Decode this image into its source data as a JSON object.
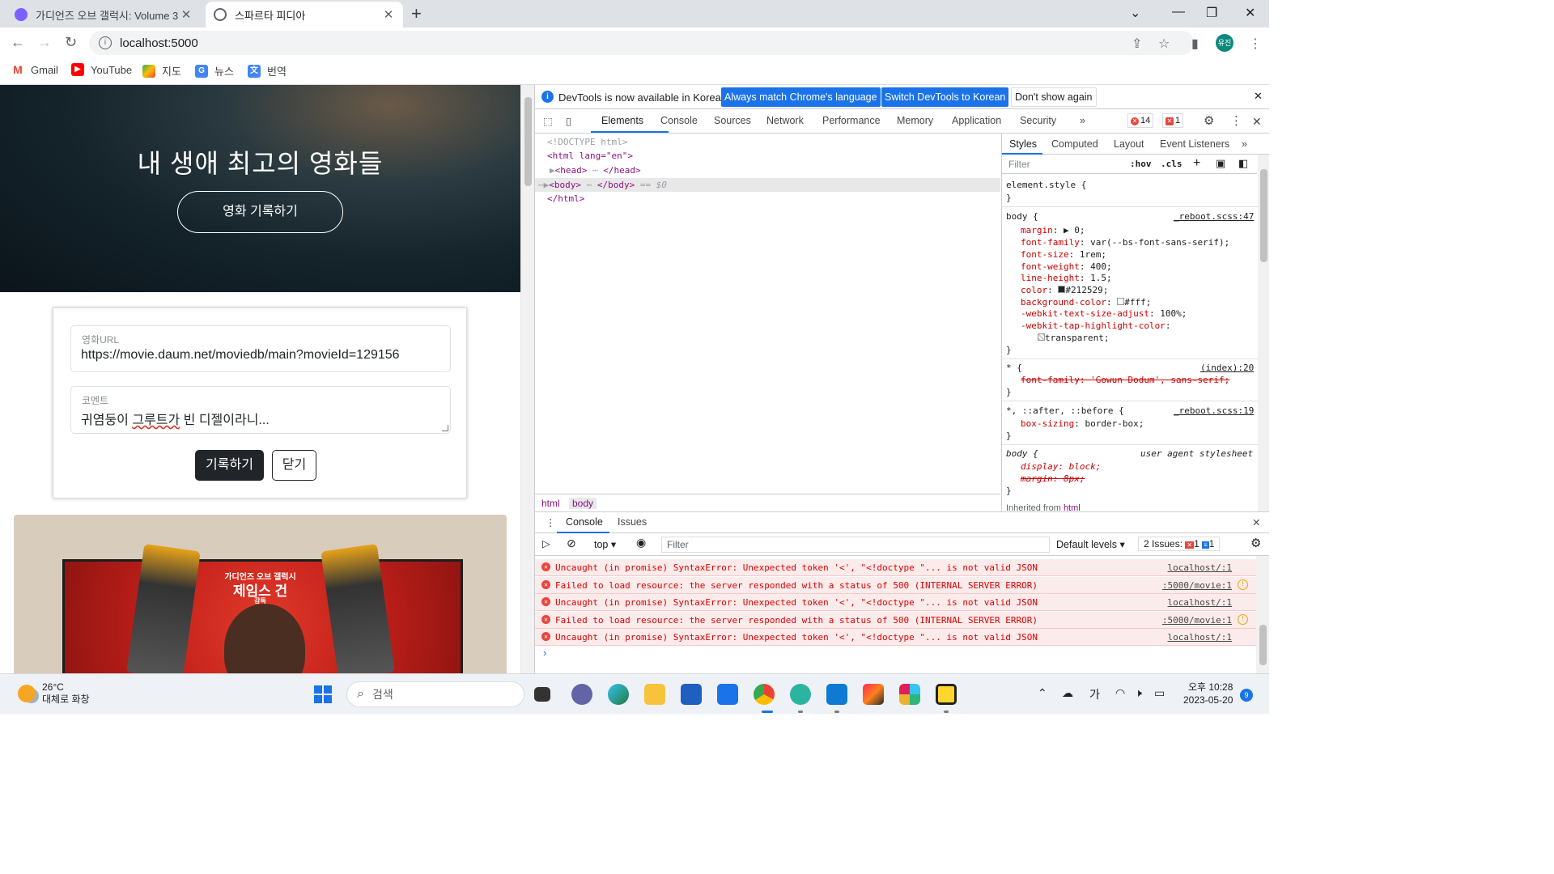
{
  "browser": {
    "tabs": [
      {
        "title": "가디언즈 오브 갤럭시: Volume 3",
        "favicon_color": "#7b61ff"
      },
      {
        "title": "스파르타 피디아",
        "favicon_color": "#5f6368"
      }
    ],
    "url": "localhost:5000",
    "profile": "유진",
    "bookmarks": [
      {
        "label": "Gmail",
        "icon": "gmail-icon",
        "color": "#ea4335"
      },
      {
        "label": "YouTube",
        "icon": "youtube-icon",
        "color": "#ff0000"
      },
      {
        "label": "지도",
        "icon": "maps-icon",
        "color": "#34a853"
      },
      {
        "label": "뉴스",
        "icon": "news-icon",
        "color": "#4285f4"
      },
      {
        "label": "번역",
        "icon": "translate-icon",
        "color": "#4285f4"
      }
    ]
  },
  "page": {
    "hero_title": "내 생애 최고의 영화들",
    "hero_button": "영화 기록하기",
    "form": {
      "url_label": "영화URL",
      "url_value": "https://movie.daum.net/moviedb/main?movieId=129156",
      "comment_label": "코멘트",
      "comment_before": "귀염둥이 ",
      "comment_misspelled": "그루트가",
      "comment_after": " 빈 디젤이라니...",
      "submit": "기록하기",
      "close": "닫기"
    },
    "poster": {
      "subtitle": "가디언즈 오브 갤럭시",
      "title": "제임스 건",
      "credit": "감독"
    }
  },
  "devtools": {
    "banner": {
      "message": "DevTools is now available in Korean!",
      "btn_match": "Always match Chrome's language",
      "btn_switch": "Switch DevTools to Korean",
      "btn_dismiss": "Don't show again"
    },
    "tabs": [
      "Elements",
      "Console",
      "Sources",
      "Network",
      "Performance",
      "Memory",
      "Application",
      "Security"
    ],
    "error_count": "14",
    "issue_count": "1",
    "dom": {
      "doctype": "<!DOCTYPE html>",
      "html_open": "<html lang=\"en\">",
      "head": "<head>",
      "head_close": "</head>",
      "body": "<body>",
      "body_close": "</body>",
      "body_ref": "== $0",
      "html_close": "</html>"
    },
    "breadcrumbs": [
      "html",
      "body"
    ],
    "styles_tabs": [
      "Styles",
      "Computed",
      "Layout",
      "Event Listeners"
    ],
    "styles_filter": "Filter",
    "hov": ":hov",
    "cls": ".cls",
    "rules": {
      "element_style": "element.style {",
      "close_brace": "}",
      "body_selector": "body {",
      "body_source": "_reboot.scss:47",
      "body_props": [
        {
          "name": "margin",
          "value": "▶ 0;"
        },
        {
          "name": "font-family",
          "value": "var(--bs-font-sans-serif);"
        },
        {
          "name": "font-size",
          "value": "1rem;"
        },
        {
          "name": "font-weight",
          "value": "400;"
        },
        {
          "name": "line-height",
          "value": "1.5;"
        },
        {
          "name": "color",
          "value": "#212529;"
        },
        {
          "name": "background-color",
          "value": "#fff;"
        },
        {
          "name": "-webkit-text-size-adjust",
          "value": "100%;"
        },
        {
          "name": "-webkit-tap-highlight-color",
          "value": ""
        }
      ],
      "tap_value": "transparent;",
      "star_selector": "* {",
      "star_source": "(index):20",
      "star_prop": "font-family: 'Gowun Dodum', sans-serif;",
      "box_selector": "*, ::after, ::before {",
      "box_source": "_reboot.scss:19",
      "box_prop_name": "box-sizing",
      "box_prop_value": "border-box;",
      "ua_selector": "body {",
      "ua_label": "user agent stylesheet",
      "ua_display": "display: block;",
      "ua_margin": "margin: 8px;",
      "inherited": "Inherited from"
    },
    "drawer_tabs": [
      "Console",
      "Issues"
    ],
    "console": {
      "context": "top",
      "filter_placeholder": "Filter",
      "levels": "Default levels",
      "issues_label": "2 Issues:",
      "issues_err": "1",
      "issues_info": "1",
      "messages": [
        {
          "text": "Uncaught (in promise) SyntaxError: Unexpected token '<', \"<!doctype \"... is not valid JSON",
          "source": "localhost/:1",
          "warn": false
        },
        {
          "text": "Failed to load resource: the server responded with a status of 500 (INTERNAL SERVER ERROR)",
          "source": ":5000/movie:1",
          "warn": true
        },
        {
          "text": "Uncaught (in promise) SyntaxError: Unexpected token '<', \"<!doctype \"... is not valid JSON",
          "source": "localhost/:1",
          "warn": false
        },
        {
          "text": "Failed to load resource: the server responded with a status of 500 (INTERNAL SERVER ERROR)",
          "source": ":5000/movie:1",
          "warn": true
        },
        {
          "text": "Uncaught (in promise) SyntaxError: Unexpected token '<', \"<!doctype \"... is not valid JSON",
          "source": "localhost/:1",
          "warn": false
        }
      ]
    }
  },
  "taskbar": {
    "temp": "26°C",
    "weather": "대체로 화창",
    "search": "검색",
    "ime": "가",
    "time": "오후 10:28",
    "date": "2023-05-20",
    "notifications": "9"
  }
}
